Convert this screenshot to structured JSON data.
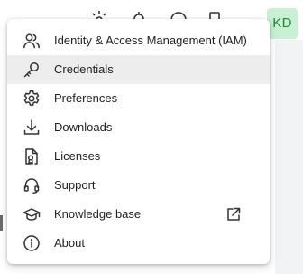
{
  "user": {
    "initials": "KD"
  },
  "menu": {
    "items": [
      {
        "label": "Identity & Access Management (IAM)",
        "icon": "users-icon"
      },
      {
        "label": "Credentials",
        "icon": "key-icon",
        "active": true
      },
      {
        "label": "Preferences",
        "icon": "gear-icon"
      },
      {
        "label": "Downloads",
        "icon": "download-icon"
      },
      {
        "label": "Licenses",
        "icon": "license-icon"
      },
      {
        "label": "Support",
        "icon": "headset-icon"
      },
      {
        "label": "Knowledge base",
        "icon": "graduation-cap-icon",
        "external": true
      },
      {
        "label": "About",
        "icon": "info-icon"
      }
    ]
  },
  "colors": {
    "active_row": "#ededed",
    "avatar_bg": "#c8f0d2",
    "avatar_text": "#1e8a3c"
  }
}
